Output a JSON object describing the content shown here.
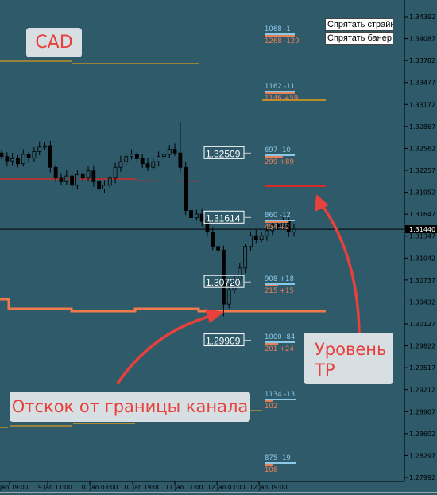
{
  "chart_data": {
    "type": "candlestick",
    "symbol_note": "CAD",
    "y_ticks": [
      "1.34392",
      "1.34087",
      "1.33782",
      "1.33477",
      "1.33172",
      "1.32867",
      "1.32562",
      "1.32257",
      "1.31952",
      "1.31647",
      "1.31347",
      "1.31042",
      "1.30737",
      "1.30432",
      "1.30127",
      "1.29822",
      "1.29517",
      "1.29212",
      "1.28907",
      "1.28602",
      "1.28297",
      "1.27992"
    ],
    "ylim": [
      1.27992,
      1.34392
    ],
    "current_price": "1.31440",
    "x_ticks": [
      "Jan 19:00",
      "9 Jan 11:00",
      "10 Jan 03:00",
      "10 Jan 19:00",
      "11 Jan 11:00",
      "12 Jan 03:00",
      "12 Jan 19:00"
    ],
    "closes": [
      1.3245,
      1.3239,
      1.3242,
      1.3235,
      1.3248,
      1.3243,
      1.3252,
      1.3258,
      1.326,
      1.323,
      1.3215,
      1.321,
      1.3218,
      1.3205,
      1.322,
      1.3215,
      1.3225,
      1.321,
      1.32,
      1.3205,
      1.3215,
      1.323,
      1.3238,
      1.3245,
      1.3248,
      1.3242,
      1.3235,
      1.323,
      1.3238,
      1.3245,
      1.3248,
      1.3255,
      1.325,
      1.323,
      1.317,
      1.316,
      1.3165,
      1.3155,
      1.314,
      1.312,
      1.3115,
      1.304,
      1.306,
      1.3075,
      1.309,
      1.312,
      1.3135,
      1.313,
      1.3135,
      1.3142,
      1.315,
      1.3148,
      1.3155,
      1.314,
      1.3144
    ],
    "period_high": 1.3293,
    "period_low": 1.3023,
    "strike_levels": [
      "1.32509",
      "1.31614",
      "1.30720",
      "1.29909"
    ],
    "stats": [
      {
        "blue": "1068 -1",
        "orange": "1268 -129"
      },
      {
        "blue": "1162 -11",
        "orange": "1146 +59"
      },
      {
        "blue": "697 -10",
        "orange": "299 +89"
      },
      {
        "blue": "860 -12",
        "orange": "454 +2"
      },
      {
        "blue": "908 +18",
        "orange": "215 +15"
      },
      {
        "blue": "1000 -84",
        "orange": "201 +24"
      },
      {
        "blue": "1134 -13",
        "orange": "102"
      },
      {
        "blue": "875 -19",
        "orange": "108"
      }
    ],
    "colors": {
      "background": "#2e5a6a",
      "candle": "#000000",
      "channel": "#f07a4a",
      "red_level": "#d42a2a",
      "gold_level": "#b8902a",
      "blue_text": "#8cc8e8",
      "orange_text": "#e88058",
      "annotation": "#e8403a"
    }
  },
  "buttons": {
    "hide_strike": "Спрятать страйк",
    "hide_banner": "Спрятать банер"
  },
  "annotations": {
    "cad": "CAD",
    "bounce": "Отскок от границы канала",
    "tp_line1": "Уровень",
    "tp_line2": "TP"
  }
}
